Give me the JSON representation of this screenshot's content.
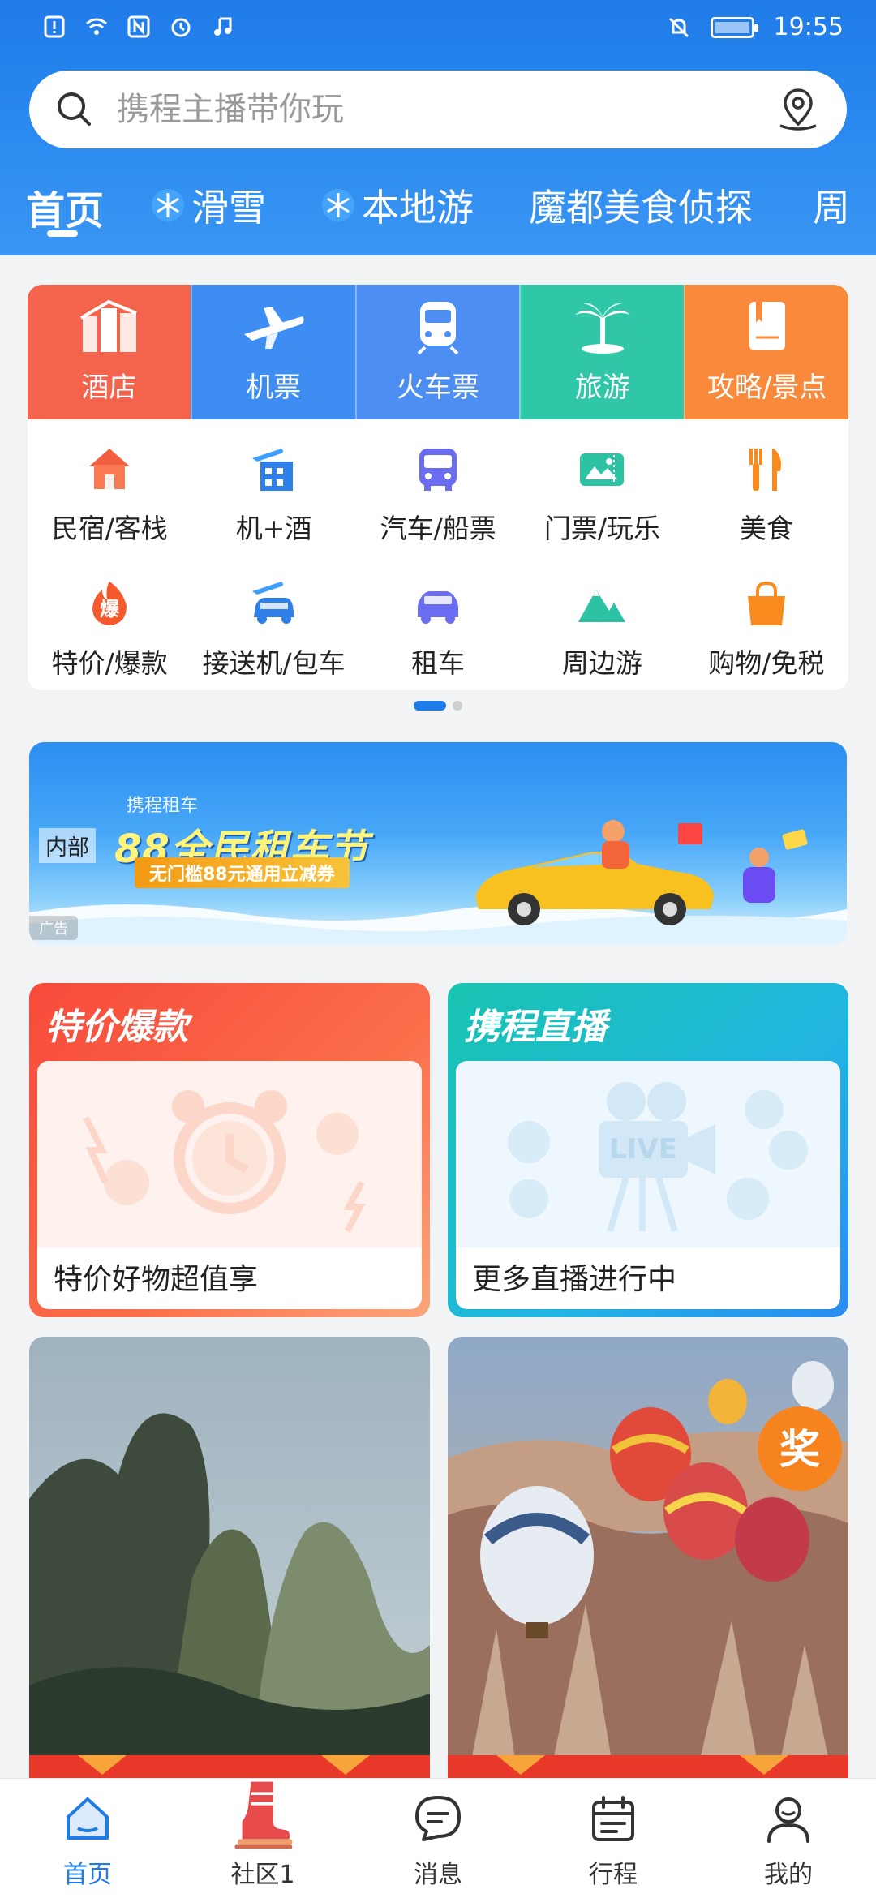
{
  "status_bar": {
    "time": "19:55"
  },
  "search": {
    "placeholder": "携程主播带你玩"
  },
  "tabs": [
    {
      "label": "首页",
      "active": true
    },
    {
      "label": "滑雪",
      "icon": "snowflake-icon"
    },
    {
      "label": "本地游",
      "icon": "snowflake-icon"
    },
    {
      "label": "魔都美食侦探"
    },
    {
      "label": "周"
    }
  ],
  "main_services": [
    {
      "label": "酒店",
      "icon": "hotel-icon",
      "color": "#f4644d"
    },
    {
      "label": "机票",
      "icon": "airplane-icon",
      "color": "#3d8df2"
    },
    {
      "label": "火车票",
      "icon": "train-icon",
      "color": "#4c8ef2"
    },
    {
      "label": "旅游",
      "icon": "palm-tree-icon",
      "color": "#2fc7a7"
    },
    {
      "label": "攻略/景点",
      "icon": "guidebook-icon",
      "color": "#f98a3c"
    }
  ],
  "sub_services": [
    {
      "label": "民宿/客栈",
      "icon": "house-icon"
    },
    {
      "label": "机+酒",
      "icon": "flight-hotel-icon"
    },
    {
      "label": "汽车/船票",
      "icon": "bus-icon"
    },
    {
      "label": "门票/玩乐",
      "icon": "ticket-icon"
    },
    {
      "label": "美食",
      "icon": "fork-knife-icon"
    },
    {
      "label": "特价/爆款",
      "icon": "fire-badge-icon",
      "badge": "爆"
    },
    {
      "label": "接送机/包车",
      "icon": "airport-transfer-icon"
    },
    {
      "label": "租车",
      "icon": "car-icon"
    },
    {
      "label": "周边游",
      "icon": "mountain-icon"
    },
    {
      "label": "购物/免税",
      "icon": "shopping-bag-icon"
    }
  ],
  "banner": {
    "tag": "内部",
    "ad_label": "广告",
    "brand": "携程租车",
    "title": "88全民租车节",
    "promo": "无门槛88元通用立减券"
  },
  "promo_cards": [
    {
      "title": "特价爆款",
      "text": "特价好物超值享"
    },
    {
      "title": "携程直播",
      "text": "更多直播进行中"
    }
  ],
  "photo_badge": "奖",
  "bottom_nav": [
    {
      "label": "首页",
      "icon": "home-icon",
      "active": true
    },
    {
      "label": "社区1",
      "icon": "ski-boot-icon"
    },
    {
      "label": "消息",
      "icon": "message-icon"
    },
    {
      "label": "行程",
      "icon": "calendar-icon"
    },
    {
      "label": "我的",
      "icon": "profile-icon"
    }
  ]
}
